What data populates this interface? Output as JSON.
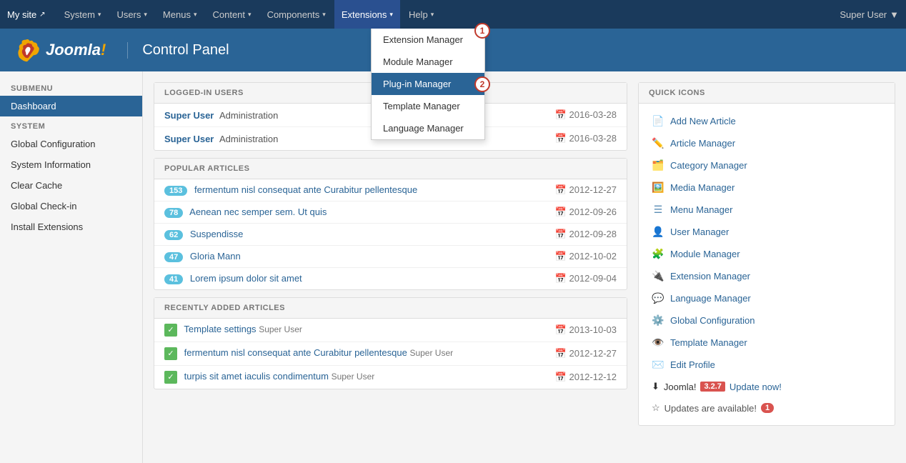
{
  "topbar": {
    "site_label": "My site",
    "site_icon": "↗",
    "nav_items": [
      {
        "id": "system",
        "label": "System",
        "has_arrow": true
      },
      {
        "id": "users",
        "label": "Users",
        "has_arrow": true
      },
      {
        "id": "menus",
        "label": "Menus",
        "has_arrow": true
      },
      {
        "id": "content",
        "label": "Content",
        "has_arrow": true
      },
      {
        "id": "components",
        "label": "Components",
        "has_arrow": true
      },
      {
        "id": "extensions",
        "label": "Extensions",
        "has_arrow": true,
        "active": true
      },
      {
        "id": "help",
        "label": "Help",
        "has_arrow": true
      }
    ],
    "super_user_label": "Super User",
    "super_user_arrow": "▼"
  },
  "header": {
    "title": "Control Panel"
  },
  "sidebar": {
    "submenu_label": "SUBMENU",
    "dashboard_label": "Dashboard",
    "system_label": "SYSTEM",
    "items": [
      {
        "id": "global-config",
        "label": "Global Configuration"
      },
      {
        "id": "system-info",
        "label": "System Information"
      },
      {
        "id": "clear-cache",
        "label": "Clear Cache"
      },
      {
        "id": "global-checkin",
        "label": "Global Check-in"
      },
      {
        "id": "install-ext",
        "label": "Install Extensions"
      }
    ]
  },
  "extensions_dropdown": {
    "items": [
      {
        "id": "extension-manager",
        "label": "Extension Manager",
        "selected": false
      },
      {
        "id": "module-manager",
        "label": "Module Manager",
        "selected": false
      },
      {
        "id": "plugin-manager",
        "label": "Plug-in Manager",
        "selected": true
      },
      {
        "id": "template-manager",
        "label": "Template Manager",
        "selected": false
      },
      {
        "id": "language-manager",
        "label": "Language Manager",
        "selected": false
      }
    ],
    "step1_label": "1",
    "step2_label": "2"
  },
  "logged_in_users": {
    "panel_title": "LOGGED-IN USERS",
    "rows": [
      {
        "name": "Super User",
        "role": "Administration",
        "date": "2016-03-28"
      },
      {
        "name": "Super User",
        "role": "Administration",
        "date": "2016-03-28"
      }
    ]
  },
  "popular_articles": {
    "panel_title": "POPULAR ARTICLES",
    "rows": [
      {
        "count": "153",
        "title": "fermentum nisl consequat ante Curabitur pellentesque",
        "date": "2012-12-27"
      },
      {
        "count": "78",
        "title": "Aenean nec semper sem. Ut quis",
        "date": "2012-09-26"
      },
      {
        "count": "62",
        "title": "Suspendisse",
        "date": "2012-09-28"
      },
      {
        "count": "47",
        "title": "Gloria Mann",
        "date": "2012-10-02"
      },
      {
        "count": "41",
        "title": "Lorem ipsum dolor sit amet",
        "date": "2012-09-04"
      }
    ]
  },
  "recently_added": {
    "panel_title": "RECENTLY ADDED ARTICLES",
    "rows": [
      {
        "title": "Template settings",
        "author": "Super User",
        "date": "2013-10-03"
      },
      {
        "title": "fermentum nisl consequat ante Curabitur pellentesque",
        "author": "Super User",
        "date": "2012-12-27"
      },
      {
        "title": "turpis sit amet iaculis condimentum",
        "author": "Super User",
        "date": "2012-12-12"
      }
    ]
  },
  "quick_icons": {
    "panel_title": "QUICK ICONS",
    "items": [
      {
        "id": "add-article",
        "icon": "📄",
        "label": "Add New Article"
      },
      {
        "id": "article-manager",
        "icon": "✏️",
        "label": "Article Manager"
      },
      {
        "id": "category-manager",
        "icon": "🗂️",
        "label": "Category Manager"
      },
      {
        "id": "media-manager",
        "icon": "🖼️",
        "label": "Media Manager"
      },
      {
        "id": "menu-manager",
        "icon": "☰",
        "label": "Menu Manager"
      },
      {
        "id": "user-manager",
        "icon": "👤",
        "label": "User Manager"
      },
      {
        "id": "module-manager",
        "icon": "🧩",
        "label": "Module Manager"
      },
      {
        "id": "extension-manager",
        "icon": "🔌",
        "label": "Extension Manager"
      },
      {
        "id": "language-manager",
        "icon": "💬",
        "label": "Language Manager"
      },
      {
        "id": "global-config",
        "icon": "⚙️",
        "label": "Global Configuration"
      },
      {
        "id": "template-manager",
        "icon": "👁️",
        "label": "Template Manager"
      },
      {
        "id": "edit-profile",
        "icon": "✉️",
        "label": "Edit Profile"
      }
    ],
    "joomla_update": {
      "icon": "⬇",
      "label": "Joomla!",
      "version": "3.2.7",
      "link": "Update now!"
    },
    "updates_available": {
      "icon": "☆",
      "label": "Updates are available!",
      "count": "1"
    }
  }
}
